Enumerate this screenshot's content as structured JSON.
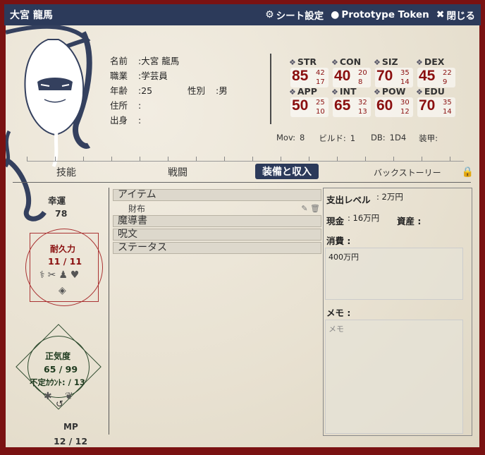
{
  "titlebar": {
    "title": "大宮 龍馬",
    "sheet_settings": "シート設定",
    "prototype_token": "Prototype Token",
    "close": "閉じる"
  },
  "profile": {
    "name_label": "名前",
    "name": "大宮 龍馬",
    "job_label": "職業",
    "job": "学芸員",
    "age_label": "年齢",
    "age": "25",
    "gender_label": "性別",
    "gender": "男",
    "address_label": "住所",
    "address": "",
    "origin_label": "出身",
    "origin": ""
  },
  "stats": [
    {
      "name": "STR",
      "value": "85",
      "half": "42",
      "fifth": "17"
    },
    {
      "name": "CON",
      "value": "40",
      "half": "20",
      "fifth": "8"
    },
    {
      "name": "SIZ",
      "value": "70",
      "half": "35",
      "fifth": "14"
    },
    {
      "name": "DEX",
      "value": "45",
      "half": "22",
      "fifth": "9"
    },
    {
      "name": "APP",
      "value": "50",
      "half": "25",
      "fifth": "10"
    },
    {
      "name": "INT",
      "value": "65",
      "half": "32",
      "fifth": "13"
    },
    {
      "name": "POW",
      "value": "60",
      "half": "30",
      "fifth": "12"
    },
    {
      "name": "EDU",
      "value": "70",
      "half": "35",
      "fifth": "14"
    }
  ],
  "derived": {
    "mov_label": "Mov:",
    "mov": "8",
    "build_label": "ビルド:",
    "build": "1",
    "db_label": "DB:",
    "db": "1D4",
    "armor_label": "装甲:"
  },
  "tabs": [
    "技能",
    "戦闘",
    "装備と収入",
    "バックストーリー"
  ],
  "active_tab": "装備と収入",
  "left": {
    "luck_label": "幸運",
    "luck": "78",
    "hp_label": "耐久力",
    "hp": "11 / 11",
    "san_label": "正気度",
    "san": "65 / 99",
    "indef_label": "不定ｶｳﾝﾄ:",
    "indef": "/ 13",
    "mp_label": "MP",
    "mp": "12 / 12"
  },
  "items": {
    "sections": [
      "アイテム",
      "魔導書",
      "呪文",
      "ステータス"
    ],
    "item_rows": [
      "財布"
    ]
  },
  "finance": {
    "spending_label": "支出レベル",
    "spending": "2万円",
    "cash_label": "現金",
    "cash": "16万円",
    "assets_label": "資産",
    "consumption_label": "消費",
    "consumption_text": "400万円",
    "memo_label": "メモ",
    "memo_placeholder": "メモ"
  }
}
